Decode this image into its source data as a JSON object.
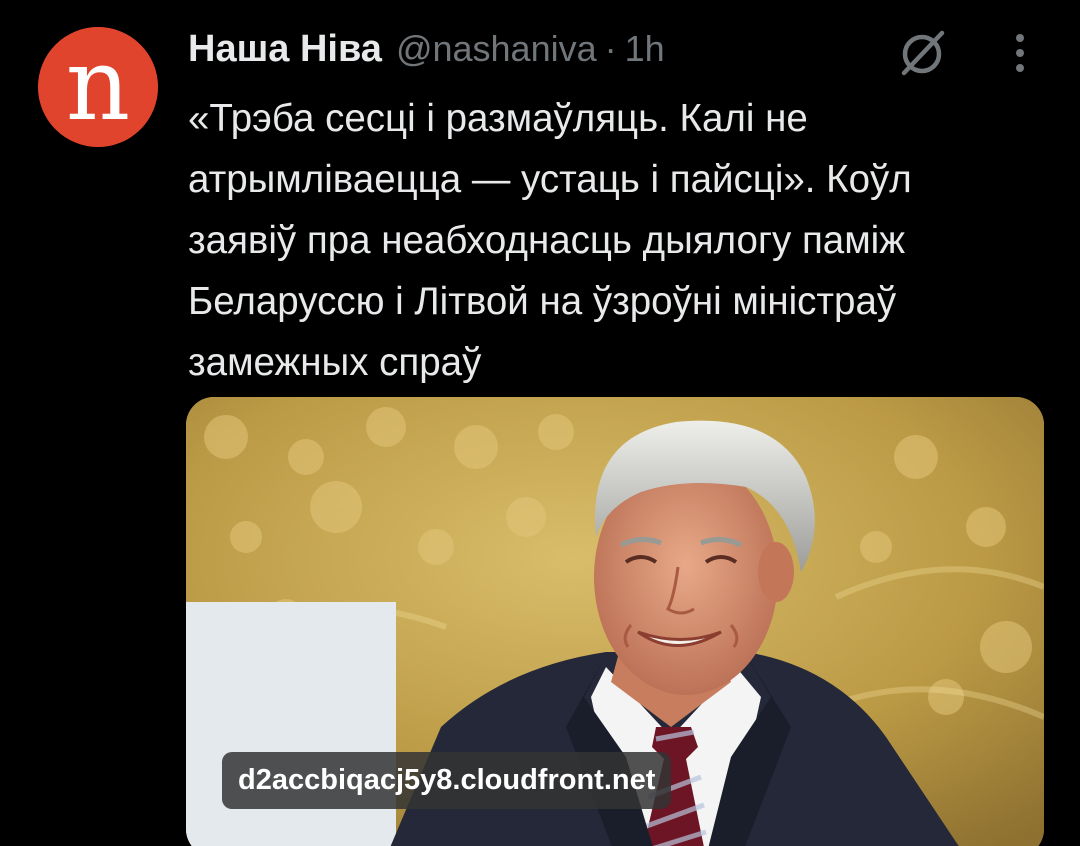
{
  "tweet": {
    "author": {
      "display_name": "Наша Ніва",
      "handle": "@nashaniva",
      "separator": "·",
      "time": "1h",
      "avatar_letter": "n",
      "avatar_color": "#e0442c"
    },
    "text": "«Трэба сесці і размаўляць. Калі не\nатрымліваецца — устаць і пайсці». Коўл\nзаявіў пра неабходнасць дыялогу паміж\nБеларуссю і Літвой на ўзроўні міністраў\nзамежных спраў",
    "media": {
      "link_label": "d2accbiqacj5y8.cloudfront.net"
    },
    "actions": {
      "grok_icon": "slashed-circle-icon",
      "more_icon": "vertical-dots-icon"
    }
  },
  "theme": {
    "background": "#000000",
    "text_primary": "#e7e9ea",
    "text_secondary": "#71767b"
  }
}
